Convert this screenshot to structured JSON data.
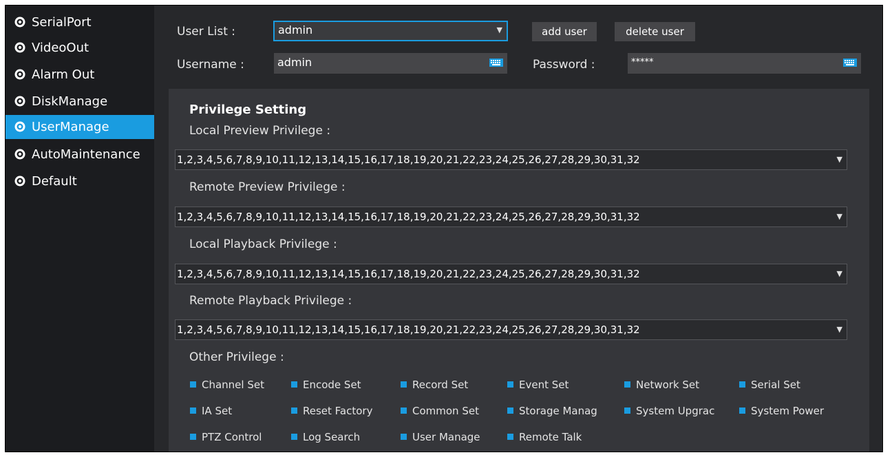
{
  "sidebar": {
    "items": [
      {
        "label": "SerialPort",
        "active": false
      },
      {
        "label": "VideoOut",
        "active": false
      },
      {
        "label": "Alarm Out",
        "active": false
      },
      {
        "label": "DiskManage",
        "active": false
      },
      {
        "label": "UserManage",
        "active": true
      },
      {
        "label": "AutoMaintenance",
        "active": false
      },
      {
        "label": "Default",
        "active": false
      }
    ]
  },
  "user": {
    "list_label": "User List :",
    "list_value": "admin",
    "add_user": "add user",
    "delete_user": "delete user",
    "username_label": "Username :",
    "username_value": "admin",
    "password_label": "Password :",
    "password_value": "*****"
  },
  "privilege": {
    "title": "Privilege Setting",
    "local_preview_label": "Local Preview Privilege :",
    "local_preview_value": "1,2,3,4,5,6,7,8,9,10,11,12,13,14,15,16,17,18,19,20,21,22,23,24,25,26,27,28,29,30,31,32",
    "remote_preview_label": "Remote Preview Privilege :",
    "remote_preview_value": "1,2,3,4,5,6,7,8,9,10,11,12,13,14,15,16,17,18,19,20,21,22,23,24,25,26,27,28,29,30,31,32",
    "local_playback_label": "Local Playback Privilege :",
    "local_playback_value": "1,2,3,4,5,6,7,8,9,10,11,12,13,14,15,16,17,18,19,20,21,22,23,24,25,26,27,28,29,30,31,32",
    "remote_playback_label": "Remote Playback Privilege :",
    "remote_playback_value": "1,2,3,4,5,6,7,8,9,10,11,12,13,14,15,16,17,18,19,20,21,22,23,24,25,26,27,28,29,30,31,32",
    "other_label": "Other Privilege :",
    "other": [
      "Channel Set",
      "Encode Set",
      "Record Set",
      "Event Set",
      "Network Set",
      "Serial Set",
      "IA Set",
      "Reset Factory",
      "Common Set",
      "Storage Manag",
      "System Upgrac",
      "System Power",
      "PTZ Control",
      "Log Search",
      "User Manage",
      "Remote Talk"
    ]
  },
  "colors": {
    "accent": "#1a9ce0",
    "sidebar_bg": "#1b1c1f",
    "panel_bg": "#35363a"
  },
  "icons": {
    "sidebar": "gear-icon",
    "dropdown": "chevron-down-icon",
    "keyboard": "keyboard-icon"
  }
}
